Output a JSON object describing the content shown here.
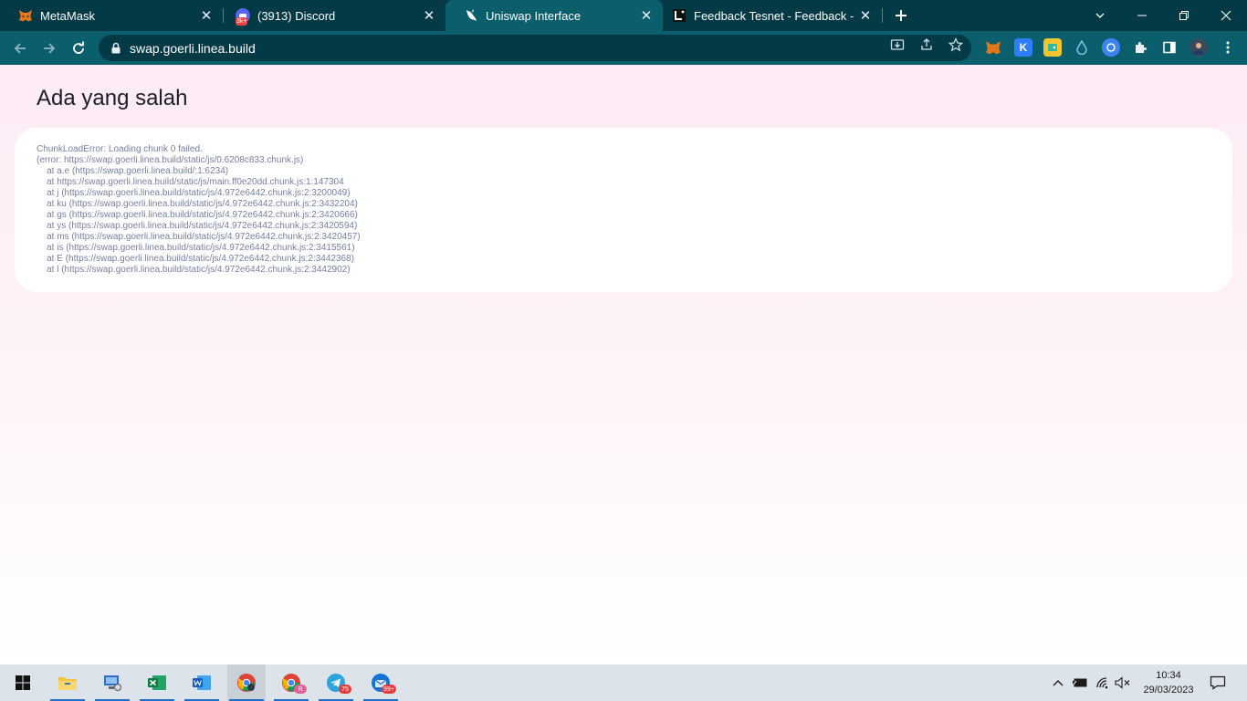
{
  "browser": {
    "tabs": [
      {
        "title": "MetaMask",
        "icon": "metamask-fox-icon",
        "active": false
      },
      {
        "title": "(3913) Discord",
        "icon": "discord-icon",
        "badge": "3k+",
        "active": false
      },
      {
        "title": "Uniswap Interface",
        "icon": "uniswap-unicorn-icon",
        "active": true
      },
      {
        "title": "Feedback Tesnet - Feedback - Lin",
        "icon": "linea-icon",
        "active": false
      }
    ],
    "address": "swap.goerli.linea.build",
    "colors": {
      "frame": "#033a45",
      "toolbar": "#0b5f6d",
      "accent": "#ffffff"
    }
  },
  "page": {
    "title": "Ada yang salah",
    "error_lines": [
      "ChunkLoadError: Loading chunk 0 failed.",
      "(error: https://swap.goerli.linea.build/static/js/0.6208c833.chunk.js)",
      "    at a.e (https://swap.goerli.linea.build/:1:6234)",
      "    at https://swap.goerli.linea.build/static/js/main.ff0e20dd.chunk.js:1:147304",
      "    at j (https://swap.goerli.linea.build/static/js/4.972e6442.chunk.js:2:3200049)",
      "    at ku (https://swap.goerli.linea.build/static/js/4.972e6442.chunk.js:2:3432204)",
      "    at gs (https://swap.goerli.linea.build/static/js/4.972e6442.chunk.js:2:3420666)",
      "    at ys (https://swap.goerli.linea.build/static/js/4.972e6442.chunk.js:2:3420594)",
      "    at ms (https://swap.goerli.linea.build/static/js/4.972e6442.chunk.js:2:3420457)",
      "    at is (https://swap.goerli.linea.build/static/js/4.972e6442.chunk.js:2:3415561)",
      "    at E (https://swap.goerli.linea.build/static/js/4.972e6442.chunk.js:2:3442368)",
      "    at l (https://swap.goerli.linea.build/static/js/4.972e6442.chunk.js:2:3442902)"
    ]
  },
  "taskbar": {
    "telegram_badge": "75",
    "thunderbird_badge": "99+",
    "chrome_profile_badge": "R",
    "time": "10:34",
    "date": "29/03/2023"
  }
}
